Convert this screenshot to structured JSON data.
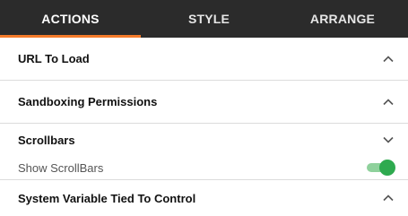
{
  "tabs": [
    {
      "label": "ACTIONS",
      "active": true
    },
    {
      "label": "STYLE",
      "active": false
    },
    {
      "label": "ARRANGE",
      "active": false
    }
  ],
  "accent_color": "#f47b2a",
  "toggle_color": "#2eaa4f",
  "sections": {
    "url_to_load": {
      "label": "URL To Load",
      "icon": "chevron-up-icon"
    },
    "sandboxing": {
      "label": "Sandboxing Permissions",
      "icon": "chevron-up-icon"
    },
    "scrollbars": {
      "label": "Scrollbars",
      "icon": "chevron-down-icon"
    },
    "system_variable": {
      "label": "System Variable Tied To Control",
      "icon": "chevron-up-icon"
    }
  },
  "show_scrollbars": {
    "label": "Show ScrollBars",
    "enabled": true
  }
}
